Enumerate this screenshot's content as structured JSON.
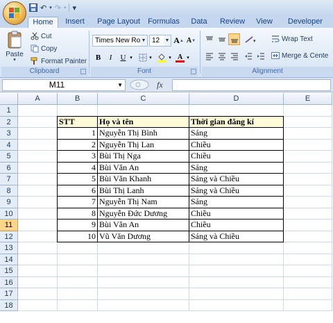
{
  "quick_access": {
    "undo_label": "↶",
    "redo_label": "↷",
    "customize_label": "▾"
  },
  "tabs": [
    "Home",
    "Insert",
    "Page Layout",
    "Formulas",
    "Data",
    "Review",
    "View",
    "Developer"
  ],
  "ribbon": {
    "clipboard": {
      "label": "Clipboard",
      "paste": "Paste",
      "cut": "Cut",
      "copy": "Copy",
      "format_painter": "Format Painter"
    },
    "font": {
      "label": "Font",
      "font_name": "Times New Rom",
      "font_size": "12",
      "grow": "A",
      "shrink": "A",
      "bold": "B",
      "italic": "I",
      "underline": "U",
      "fill_color": "#ffff00",
      "font_color": "#ff0000"
    },
    "alignment": {
      "label": "Alignment",
      "wrap_text": "Wrap Text",
      "merge_center": "Merge & Cente"
    }
  },
  "formula_bar": {
    "name_box": "M11",
    "fx": "fx",
    "formula": ""
  },
  "columns": [
    "A",
    "B",
    "C",
    "D",
    "E"
  ],
  "rows": [
    "1",
    "2",
    "3",
    "4",
    "5",
    "6",
    "7",
    "8",
    "9",
    "10",
    "11",
    "12",
    "13",
    "14",
    "15",
    "16",
    "17",
    "18"
  ],
  "selected_row": "11",
  "table": {
    "headers": [
      "STT",
      "Họ và tên",
      "Thời gian đăng kí"
    ],
    "rows": [
      [
        "1",
        "Nguyễn Thị Bình",
        "Sáng"
      ],
      [
        "2",
        "Nguyễn Thị Lan",
        "Chiều"
      ],
      [
        "3",
        "Bùi Thị Nga",
        "Chiều"
      ],
      [
        "4",
        "Bùi Văn An",
        "Sáng"
      ],
      [
        "5",
        "Bùi Văn Khanh",
        "Sáng và Chiều"
      ],
      [
        "6",
        "Bùi Thị Lanh",
        "Sáng và Chiều"
      ],
      [
        "7",
        "Nguyễn Thị Nam",
        "Sáng"
      ],
      [
        "8",
        "Nguyễn Đức Dương",
        "Chiều"
      ],
      [
        "9",
        "Bùi Văn An",
        "Chiều"
      ],
      [
        "10",
        "Vũ Văn Dương",
        "Sáng và Chiều"
      ]
    ]
  },
  "colors": {
    "header_fill": "#fefcd8",
    "selected_row": "#ffd58a",
    "ribbon_text": "#15428b"
  }
}
